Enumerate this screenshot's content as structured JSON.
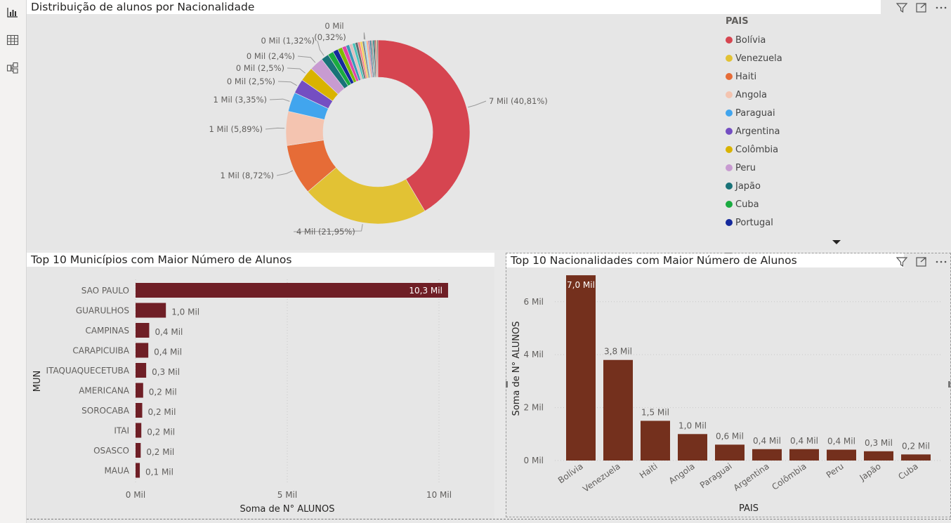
{
  "toolbar": {
    "icons": [
      "report-view-icon",
      "table-view-icon",
      "model-view-icon"
    ]
  },
  "colors": {
    "bar": "#6f1f26",
    "bar2": "#74301d",
    "panel": "#e6e6e6"
  },
  "donut": {
    "title": "Distribuição de alunos por Nacionalidade",
    "legend_title": "PAIS",
    "legend": [
      {
        "label": "Bolívia",
        "color": "#d64550"
      },
      {
        "label": "Venezuela",
        "color": "#e2c234"
      },
      {
        "label": "Haiti",
        "color": "#e66c37"
      },
      {
        "label": "Angola",
        "color": "#f4c4b0"
      },
      {
        "label": "Paraguai",
        "color": "#41a5ee"
      },
      {
        "label": "Argentina",
        "color": "#744ec2"
      },
      {
        "label": "Colômbia",
        "color": "#d9b300"
      },
      {
        "label": "Peru",
        "color": "#c89bd1"
      },
      {
        "label": "Japão",
        "color": "#197278"
      },
      {
        "label": "Cuba",
        "color": "#1aab40"
      },
      {
        "label": "Portugal",
        "color": "#15299c"
      }
    ]
  },
  "municipios": {
    "title": "Top 10 Municípios com Maior Número de Alunos"
  },
  "nacionalidades": {
    "title": "Top 10 Nacionalidades com Maior Número de Alunos"
  },
  "chart_data": [
    {
      "type": "pie",
      "title": "Distribuição de alunos por Nacionalidade",
      "legend_title": "PAIS",
      "legend_position": "right",
      "slices": [
        {
          "name": "Bolívia",
          "percent": 40.81,
          "label": "7 Mil (40,81%)"
        },
        {
          "name": "Venezuela",
          "percent": 21.95,
          "label": "4 Mil (21,95%)"
        },
        {
          "name": "Haiti",
          "percent": 8.72,
          "label": "1 Mil (8,72%)"
        },
        {
          "name": "Angola",
          "percent": 5.89,
          "label": "1 Mil (5,89%)"
        },
        {
          "name": "Paraguai",
          "percent": 3.35,
          "label": "1 Mil (3,35%)"
        },
        {
          "name": "Argentina",
          "percent": 2.5,
          "label": "0 Mil (2,5%)"
        },
        {
          "name": "Colômbia",
          "percent": 2.5,
          "label": "0 Mil (2,5%)"
        },
        {
          "name": "Peru",
          "percent": 2.4,
          "label": "0 Mil (2,4%)"
        },
        {
          "name": "Japão",
          "percent": 1.32,
          "label": "0 Mil (1,32%)"
        },
        {
          "name": "Cuba",
          "percent": 1.0,
          "label": ""
        },
        {
          "name": "Portugal",
          "percent": 0.9,
          "label": ""
        },
        {
          "name": "",
          "percent": 0.8,
          "label": ""
        },
        {
          "name": "",
          "percent": 0.7,
          "label": ""
        },
        {
          "name": "",
          "percent": 0.6,
          "label": ""
        },
        {
          "name": "",
          "percent": 0.55,
          "label": ""
        },
        {
          "name": "",
          "percent": 0.5,
          "label": ""
        },
        {
          "name": "",
          "percent": 0.45,
          "label": ""
        },
        {
          "name": "",
          "percent": 0.4,
          "label": ""
        },
        {
          "name": "",
          "percent": 0.4,
          "label": ""
        },
        {
          "name": "",
          "percent": 0.35,
          "label": ""
        },
        {
          "name": "",
          "percent": 0.32,
          "label": "0 Mil (0,32%)"
        },
        {
          "name": "",
          "percent": 0.3,
          "label": ""
        },
        {
          "name": "",
          "percent": 0.3,
          "label": ""
        },
        {
          "name": "",
          "percent": 0.25,
          "label": ""
        },
        {
          "name": "",
          "percent": 0.25,
          "label": ""
        },
        {
          "name": "",
          "percent": 0.2,
          "label": ""
        },
        {
          "name": "",
          "percent": 0.2,
          "label": ""
        },
        {
          "name": "",
          "percent": 0.2,
          "label": ""
        },
        {
          "name": "",
          "percent": 0.15,
          "label": ""
        },
        {
          "name": "",
          "percent": 0.15,
          "label": ""
        }
      ]
    },
    {
      "type": "bar",
      "orientation": "horizontal",
      "title": "Top 10 Municípios com Maior Número de Alunos",
      "xlabel": "Soma de N° ALUNOS",
      "ylabel": "MUN",
      "xlim": [
        0,
        10.5
      ],
      "xticks": [
        {
          "v": 0,
          "label": "0 Mil"
        },
        {
          "v": 5,
          "label": "5 Mil"
        },
        {
          "v": 10,
          "label": "10 Mil"
        }
      ],
      "categories": [
        "SAO PAULO",
        "GUARULHOS",
        "CAMPINAS",
        "CARAPICUIBA",
        "ITAQUAQUECETUBA",
        "AMERICANA",
        "SOROCABA",
        "ITAI",
        "OSASCO",
        "MAUA"
      ],
      "values": [
        10.3,
        1.0,
        0.45,
        0.42,
        0.35,
        0.25,
        0.22,
        0.19,
        0.17,
        0.14
      ],
      "value_labels": [
        "10,3 Mil",
        "1,0 Mil",
        "0,4 Mil",
        "0,4 Mil",
        "0,3 Mil",
        "0,2 Mil",
        "0,2 Mil",
        "0,2 Mil",
        "0,2 Mil",
        "0,1 Mil"
      ]
    },
    {
      "type": "bar",
      "title": "Top 10 Nacionalidades com Maior Número de Alunos",
      "xlabel": "PAIS",
      "ylabel": "Soma de N° ALUNOS",
      "ylim": [
        0,
        7
      ],
      "yticks": [
        {
          "v": 0,
          "label": "0 Mil"
        },
        {
          "v": 2,
          "label": "2 Mil"
        },
        {
          "v": 4,
          "label": "4 Mil"
        },
        {
          "v": 6,
          "label": "6 Mil"
        }
      ],
      "categories": [
        "Bolívia",
        "Venezuela",
        "Haiti",
        "Angola",
        "Paraguai",
        "Argentina",
        "Colômbia",
        "Peru",
        "Japão",
        "Cuba"
      ],
      "values": [
        7.0,
        3.8,
        1.5,
        1.0,
        0.6,
        0.43,
        0.43,
        0.41,
        0.35,
        0.23
      ],
      "value_labels": [
        "7,0 Mil",
        "3,8 Mil",
        "1,5 Mil",
        "1,0 Mil",
        "0,6 Mil",
        "0,4 Mil",
        "0,4 Mil",
        "0,4 Mil",
        "0,3 Mil",
        "0,2 Mil"
      ]
    }
  ]
}
